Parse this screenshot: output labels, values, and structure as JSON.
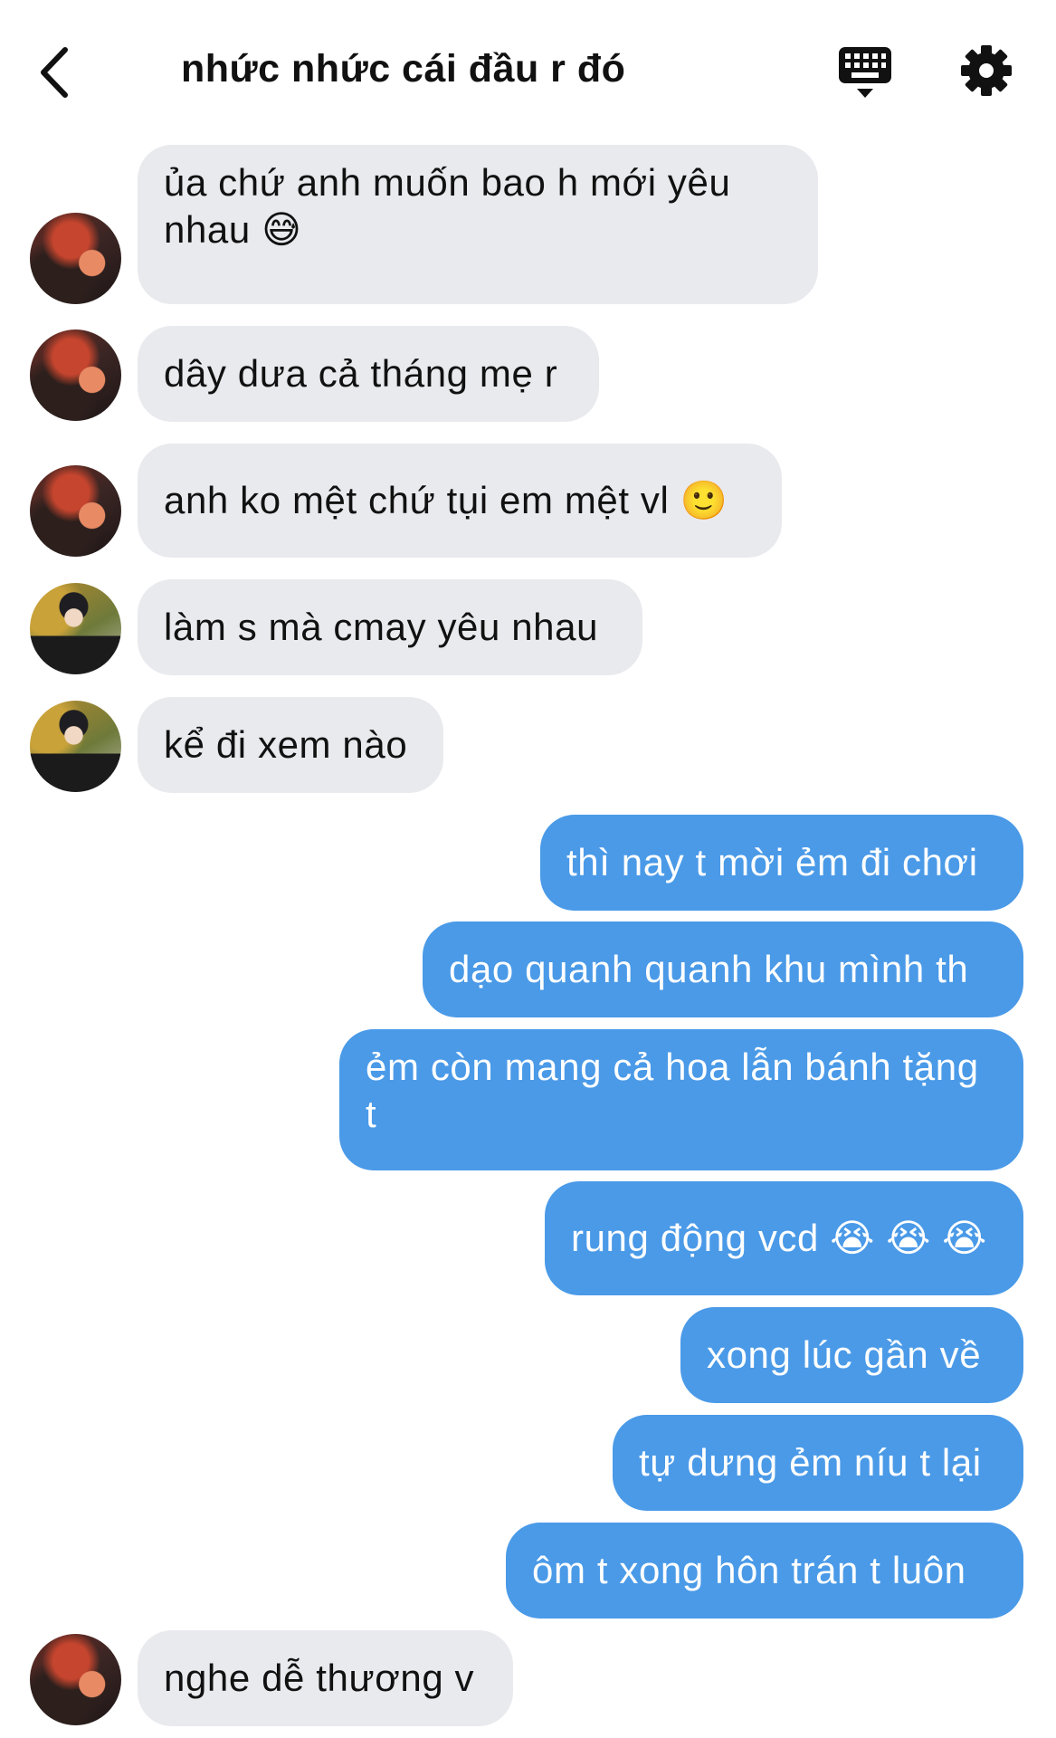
{
  "header": {
    "title": "nhức nhức cái đầu r đó"
  },
  "messages": [
    {
      "side": "in",
      "avatar": "a",
      "text": "ủa chứ anh muốn bao h mới yêu nhau 😅"
    },
    {
      "side": "in",
      "avatar": "a",
      "text": "dây dưa cả tháng mẹ r"
    },
    {
      "side": "in",
      "avatar": "a",
      "text": "anh ko mệt chứ tụi em mệt vl 🙂"
    },
    {
      "side": "in",
      "avatar": "b",
      "text": "làm s mà cmay yêu nhau"
    },
    {
      "side": "in",
      "avatar": "b",
      "text": "kể đi xem nào"
    },
    {
      "side": "out",
      "text": "thì nay t mời ẻm đi chơi"
    },
    {
      "side": "out",
      "text": "dạo quanh quanh khu mình th"
    },
    {
      "side": "out",
      "text": "ẻm còn mang cả hoa lẫn bánh tặng t"
    },
    {
      "side": "out",
      "text": "rung động vcd 😭 😭 😭"
    },
    {
      "side": "out",
      "text": "xong lúc gần về"
    },
    {
      "side": "out",
      "text": "tự dưng ẻm níu t lại"
    },
    {
      "side": "out",
      "text": "ôm t xong hôn trán t luôn"
    },
    {
      "side": "in",
      "avatar": "a",
      "text": "nghe dễ thương v"
    }
  ],
  "colors": {
    "incoming_bubble": "#e9eaee",
    "outgoing_bubble": "#4a9ae8",
    "background": "#ffffff"
  },
  "icons": [
    "back-arrow-icon",
    "keyboard-icon",
    "gear-icon"
  ]
}
